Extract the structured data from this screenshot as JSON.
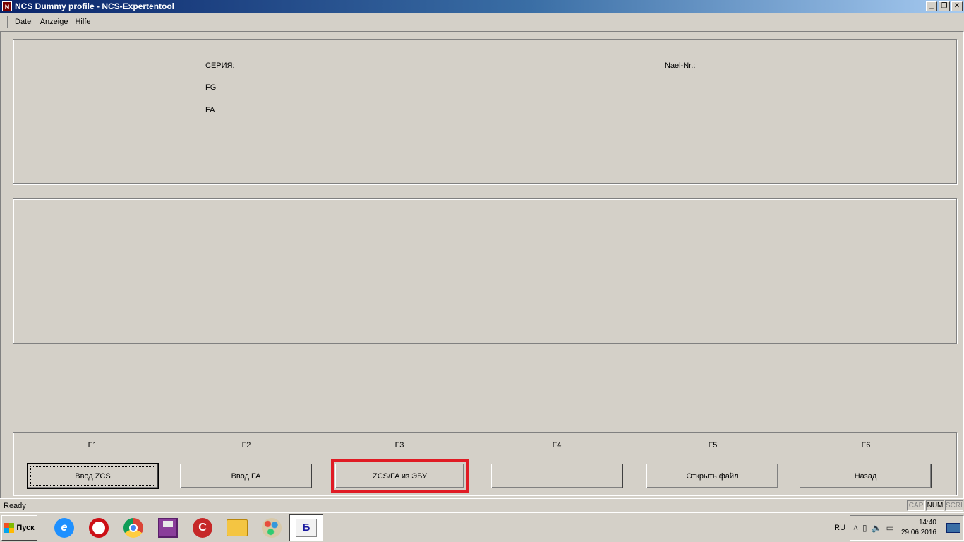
{
  "window": {
    "title": "NCS Dummy profile - NCS-Expertentool",
    "app_icon_label": "N",
    "controls": [
      "minimize-icon",
      "restore-icon",
      "close-icon"
    ]
  },
  "menu": {
    "items": [
      "Datei",
      "Anzeige",
      "Hilfe"
    ]
  },
  "info_panel": {
    "series_label": "СЕРИЯ:",
    "fg_label": "FG",
    "fa_label": "FA",
    "nael_label": "Nael-Nr.:"
  },
  "function_keys": [
    {
      "key": "F1",
      "label": "Ввод ZCS"
    },
    {
      "key": "F2",
      "label": "Ввод FA"
    },
    {
      "key": "F3",
      "label": "ZCS/FA из ЭБУ"
    },
    {
      "key": "F4",
      "label": ""
    },
    {
      "key": "F5",
      "label": "Открыть файл"
    },
    {
      "key": "F6",
      "label": "Назад"
    }
  ],
  "highlight_color": "#e01b24",
  "statusbar": {
    "text": "Ready",
    "indicators": [
      "CAP",
      "NUM",
      "SCRL"
    ],
    "active_indicator": "NUM"
  },
  "taskbar": {
    "start_label": "Пуск",
    "apps": [
      "internet-explorer-icon",
      "opera-icon",
      "chrome-icon",
      "save-disk-icon",
      "ccleaner-icon",
      "file-explorer-icon",
      "paint-icon",
      "ncs-expertentool-icon"
    ],
    "active_app": "ncs-expertentool-icon",
    "active_app_label": "Б",
    "language": "RU",
    "time": "14:40",
    "date": "29.06.2016"
  }
}
